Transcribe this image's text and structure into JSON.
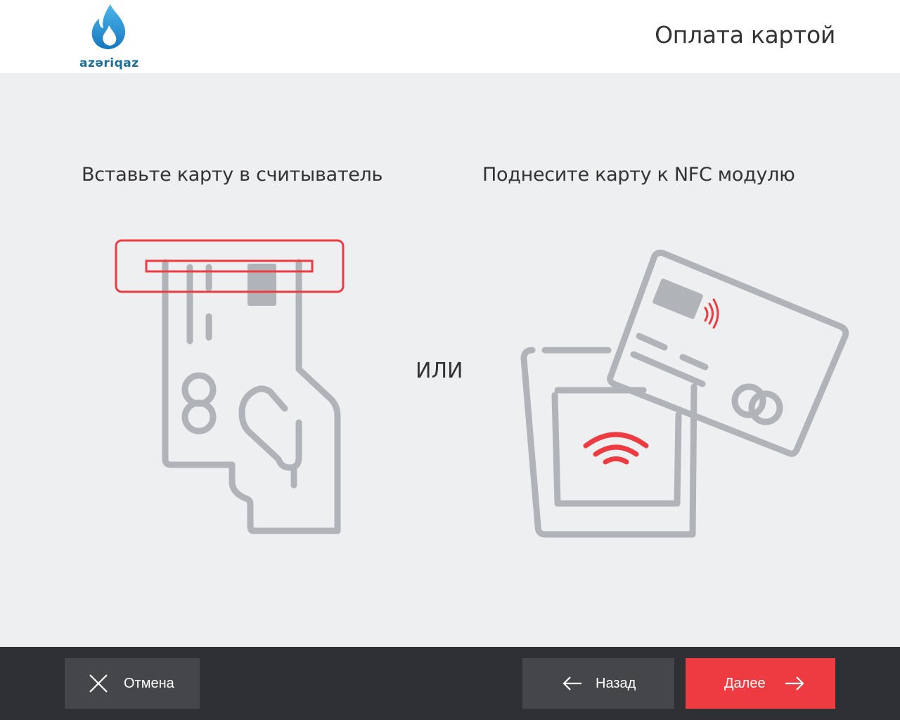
{
  "header": {
    "logo_text": "azəriqaz",
    "title": "Оплата картой"
  },
  "main": {
    "insert_title": "Вставьте карту в считыватель",
    "nfc_title": "Поднесите карту к NFC модулю",
    "or_label": "ИЛИ"
  },
  "footer": {
    "cancel_label": "Отмена",
    "back_label": "Назад",
    "next_label": "Далее"
  },
  "colors": {
    "accent": "#ee3b41",
    "illustration_gray": "#b0b4b8",
    "brand_blue": "#1c6f97",
    "footer_bg": "#2f3033"
  }
}
